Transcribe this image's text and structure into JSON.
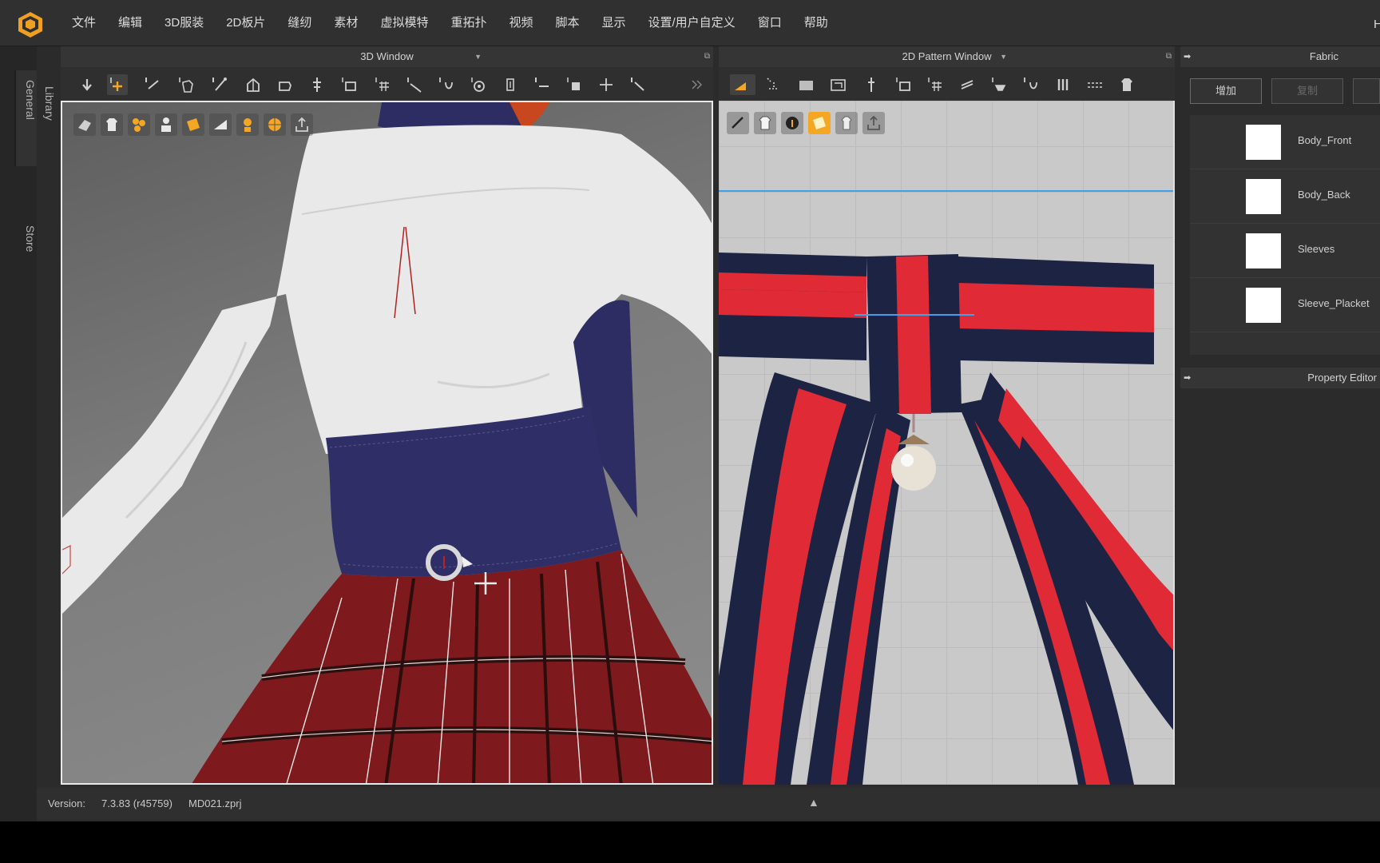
{
  "menu": [
    "文件",
    "编辑",
    "3D服装",
    "2D板片",
    "缝纫",
    "素材",
    "虚拟模特",
    "重拓扑",
    "视频",
    "脚本",
    "显示",
    "设置/用户自定义",
    "窗口",
    "帮助"
  ],
  "menu_overflow": "H",
  "left_tabs": {
    "general": "General",
    "store": "Store",
    "library": "Library"
  },
  "panels": {
    "view3d_title": "3D Window",
    "view2d_title": "2D Pattern Window",
    "fabric_title": "Fabric",
    "property_title": "Property Editor"
  },
  "fabric": {
    "add_label": "增加",
    "copy_label": "复制",
    "items": [
      {
        "name": "Body_Front",
        "color": "#ffffff"
      },
      {
        "name": "Body_Back",
        "color": "#ffffff"
      },
      {
        "name": "Sleeves",
        "color": "#ffffff"
      },
      {
        "name": "Sleeve_Placket",
        "color": "#ffffff"
      }
    ]
  },
  "status": {
    "version_label": "Version:",
    "version_value": "7.3.83 (r45759)",
    "file_name": "MD021.zprj"
  },
  "colors": {
    "accent": "#f5a623",
    "shirt": "#ededed",
    "corset": "#2e2d63",
    "skirt": "#7e1a1e",
    "ribbon_navy": "#1d2343",
    "ribbon_red": "#e02a36",
    "guide_line": "#3fa2e8"
  },
  "icons": {
    "logo": "marvelous-designer-logo",
    "toolbar3d": [
      "select-move-icon",
      "transform-pattern-icon",
      "edit-pattern-icon",
      "tack-icon",
      "fold-arrange-icon",
      "pin-icon",
      "measure-icon",
      "texture-icon",
      "puckering-icon",
      "zipper-icon",
      "button-icon",
      "grid-icon"
    ],
    "toolbar2d": [
      "transform-icon",
      "edit-point-icon",
      "rectangle-icon",
      "polygon-icon",
      "internal-line-icon",
      "sewing-icon",
      "grid-icon",
      "fold-icon",
      "pleat-icon",
      "edit-uv-icon",
      "topstitch-icon",
      "segment-icon",
      "garment-icon"
    ]
  }
}
